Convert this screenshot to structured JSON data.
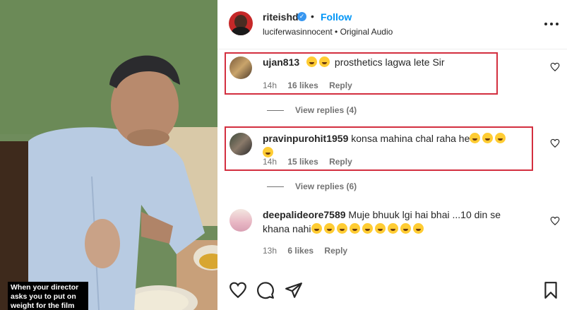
{
  "video": {
    "caption": "When your director asks you to put on weight for the film"
  },
  "header": {
    "username": "riteishd",
    "dot": "•",
    "follow_label": "Follow",
    "audio": "luciferwasinnocent • Original Audio"
  },
  "comments": [
    {
      "username": "ujan813",
      "emoji_prefix": 2,
      "text": "prosthetics lagwa lete Sir",
      "time": "14h",
      "likes": "16 likes",
      "reply": "Reply",
      "view_replies": "View replies (4)"
    },
    {
      "username": "pravinpurohit1959",
      "text": "konsa mahina chal raha he",
      "emoji_suffix": 4,
      "time": "14h",
      "likes": "15 likes",
      "reply": "Reply",
      "view_replies": "View replies (6)"
    },
    {
      "username": "deepalideore7589",
      "text": "Muje bhuuk lgi hai bhai ...10 din se khana nahi",
      "emoji_suffix": 9,
      "time": "13h",
      "likes": "6 likes",
      "reply": "Reply"
    }
  ],
  "colors": {
    "accent": "#0095f6",
    "verified": "#3897f0",
    "highlight": "#d32f3f"
  },
  "icons": [
    "heart-icon",
    "comment-icon",
    "share-icon",
    "bookmark-icon",
    "more-icon",
    "verified-icon"
  ]
}
